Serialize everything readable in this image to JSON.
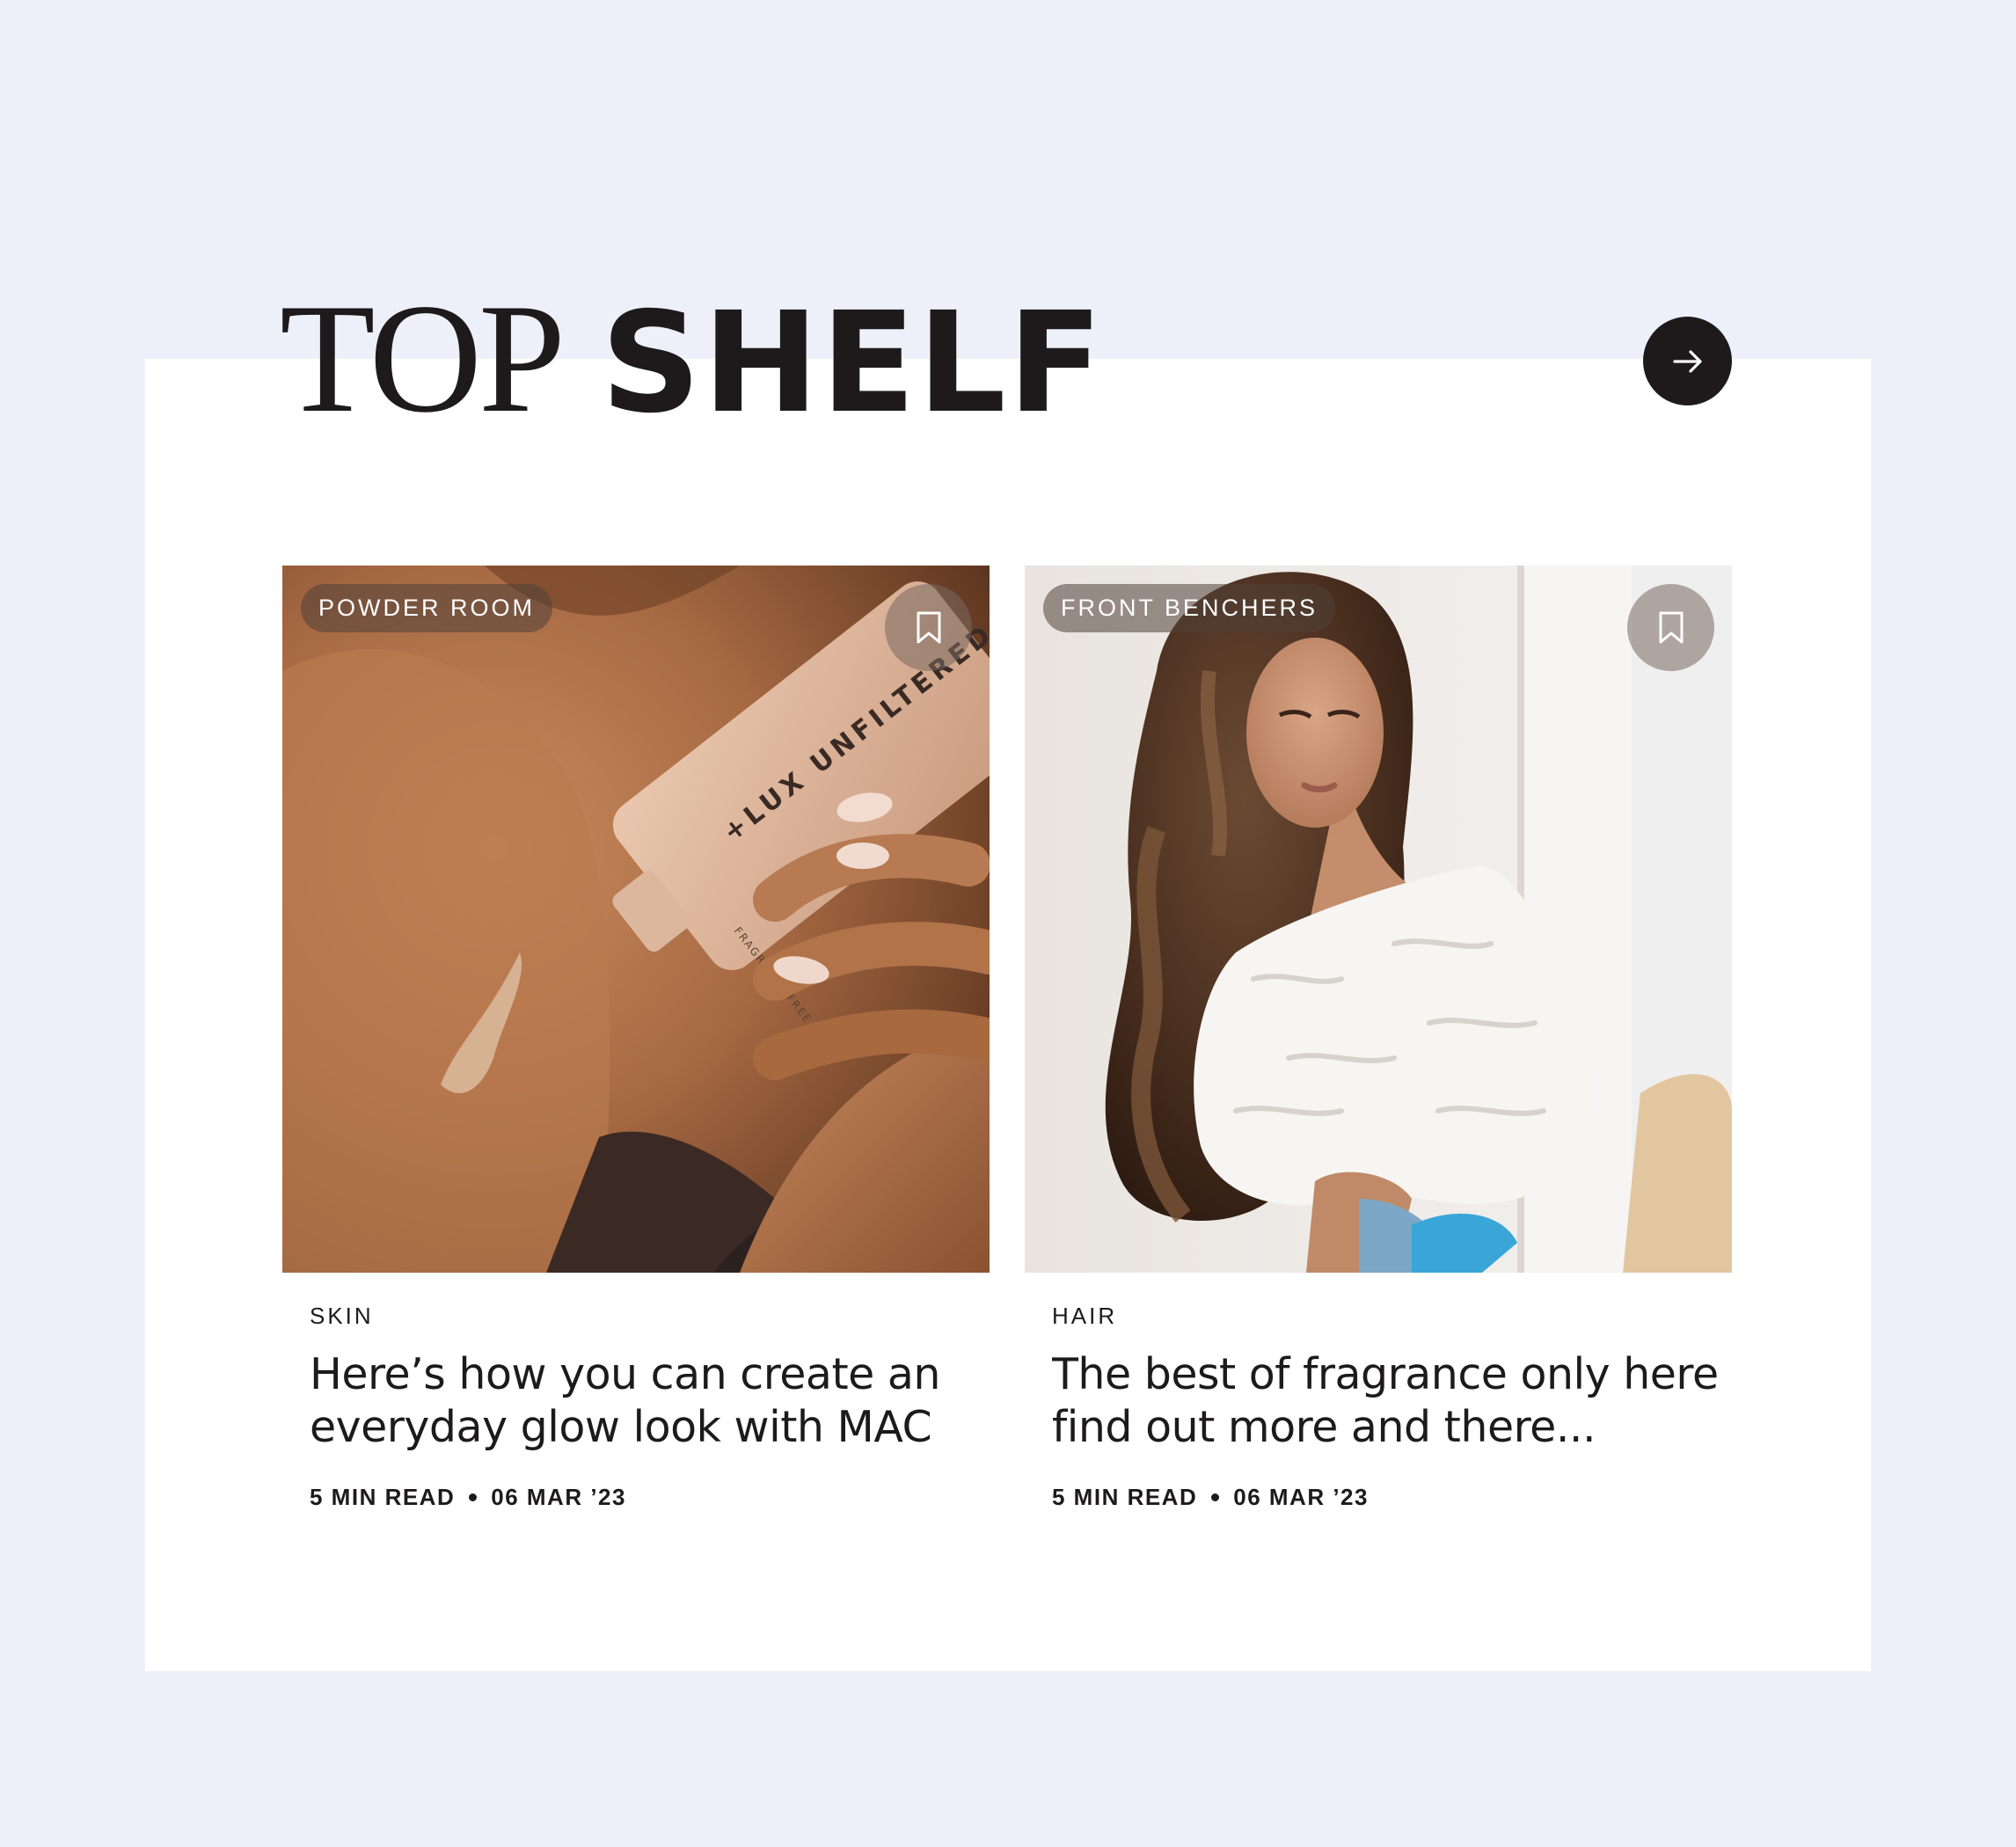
{
  "section": {
    "title_light": "TOP",
    "title_bold": "SHELF",
    "next_icon": "arrow-right-icon"
  },
  "cards": [
    {
      "tag": "POWDER ROOM",
      "bookmark_icon": "bookmark-icon",
      "category": "SKIN",
      "title": "Here’s how you can create an everyday glow look with MAC",
      "read_time": "5 MIN READ",
      "date": "06 MAR ’23",
      "image": {
        "subject": "hand applying product tube to shoulder",
        "product_text": "+LUX UNFILTERED",
        "product_small_text": "FRAGRANCE FREE"
      }
    },
    {
      "tag": "FRONT BENCHERS",
      "bookmark_icon": "bookmark-icon",
      "category": "HAIR",
      "title": "The best of fragrance only here find out more and there...",
      "read_time": "5 MIN READ",
      "date": "06 MAR ’23",
      "image": {
        "subject": "woman with long wavy hair in white ruffled top"
      }
    }
  ],
  "colors": {
    "page_bg": "#edf0f8",
    "panel_bg": "#ffffff",
    "ink": "#1e1a1c"
  }
}
